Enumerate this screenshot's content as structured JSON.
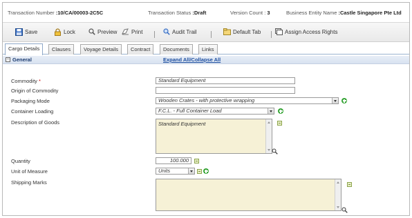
{
  "header": {
    "transaction_number_label": "Transaction Number",
    "transaction_number_value": ":10/CA/00003-2C5C",
    "transaction_status_label": "Transaction Status",
    "transaction_status_value": ":Draft",
    "version_count_label": "Version Count :",
    "version_count_value": "3",
    "business_entity_label": "Business Entity Name",
    "business_entity_value": ":Castle Singapore Pte Ltd"
  },
  "toolbar": {
    "save": "Save",
    "lock": "Lock",
    "preview": "Preview",
    "print": "Print",
    "audit_trail": "Audit Trail",
    "default_tab": "Default Tab",
    "assign_access_rights": "Assign Access Rights"
  },
  "tabs": [
    "Cargo Details",
    "Clauses",
    "Voyage Details",
    "Contract",
    "Documents",
    "Links"
  ],
  "section": {
    "title": "General",
    "toggle": "−",
    "expand_collapse": "Expand All/Collapse All"
  },
  "form": {
    "commodity": {
      "label": "Commodity",
      "required_mark": "*",
      "value": "Standard Equipment"
    },
    "origin": {
      "label": "Origin of Commodity",
      "value": ""
    },
    "packaging_mode": {
      "label": "Packaging Mode",
      "value": "Wooden Crates - with protective wrapping"
    },
    "container_loading": {
      "label": "Container Loading",
      "value": "F.C.L. - Full Container Load"
    },
    "description": {
      "label": "Description of Goods",
      "value": "Standard Equipment"
    },
    "quantity": {
      "label": "Quantity",
      "value": "100.000"
    },
    "unit_of_measure": {
      "label": "Unit of Measure",
      "value": "Units"
    },
    "shipping_marks": {
      "label": "Shipping Marks",
      "value": ""
    }
  },
  "icons": {
    "save": "floppy-disk-icon",
    "lock": "lock-icon",
    "preview": "magnifier-icon",
    "print": "printer-icon",
    "audit": "audit-magnifier-icon",
    "default_tab": "tab-icon",
    "access": "key-icon",
    "add": "green-plus-icon",
    "note": "note-icon",
    "zoom": "zoom-icon"
  },
  "colors": {
    "accent": "#1e4fa0",
    "section_bg": "#dde6f3",
    "textarea_bg": "#f6f1d6",
    "required": "#cc0000",
    "add_green": "#3aa63a"
  }
}
